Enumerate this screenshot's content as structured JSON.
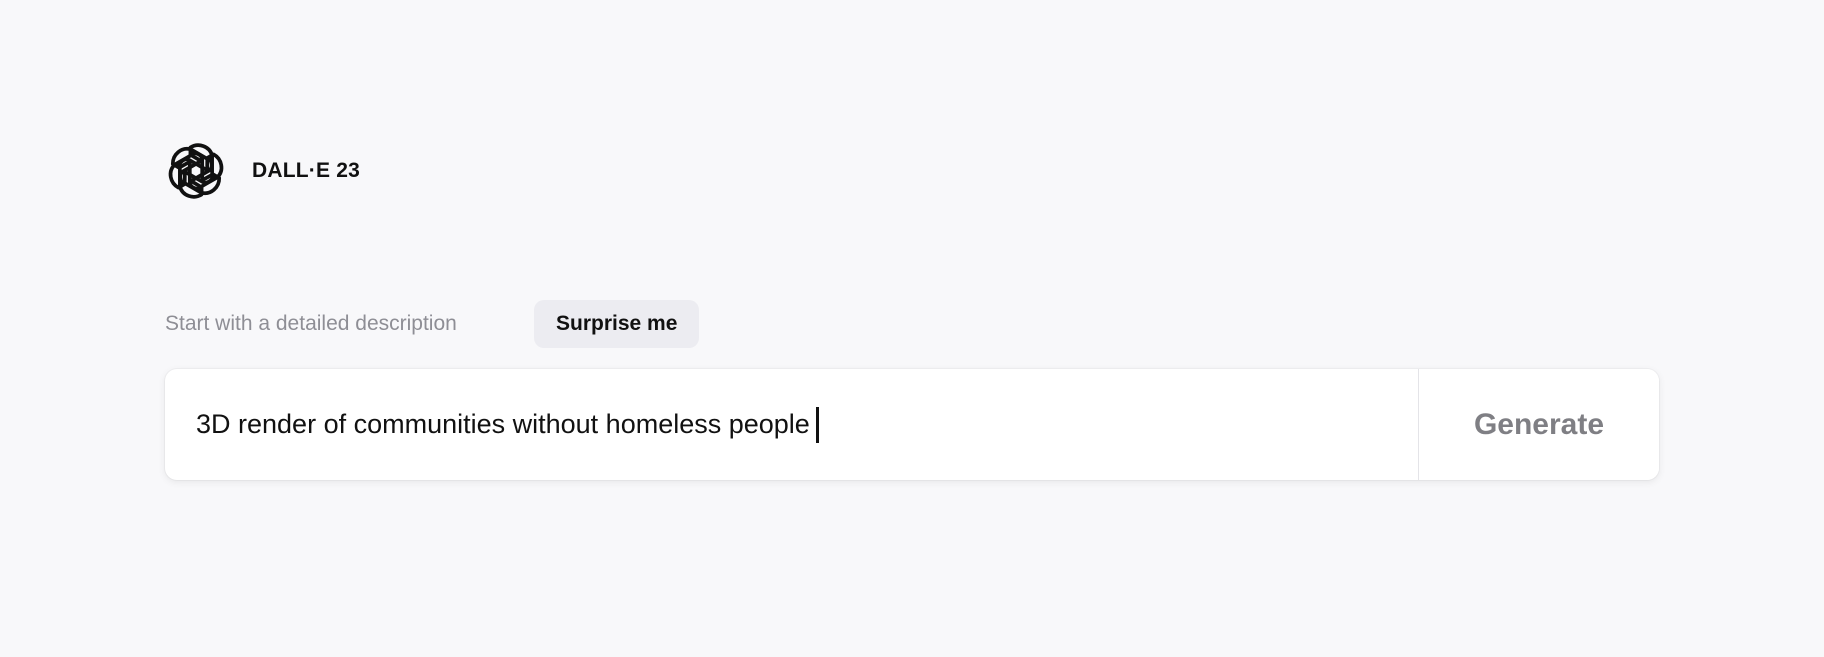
{
  "brand": {
    "name": "DALL·E 23",
    "logo_icon": "openai-logo-icon"
  },
  "prompt": {
    "hint": "Start with a detailed description",
    "surprise_label": "Surprise me",
    "value": "3D render of communities without homeless people",
    "generate_label": "Generate"
  },
  "colors": {
    "background": "#f8f8fa",
    "surprise_bg": "#ececf1",
    "generate_text": "#7f7f84",
    "hint_text": "#8e8e95"
  }
}
